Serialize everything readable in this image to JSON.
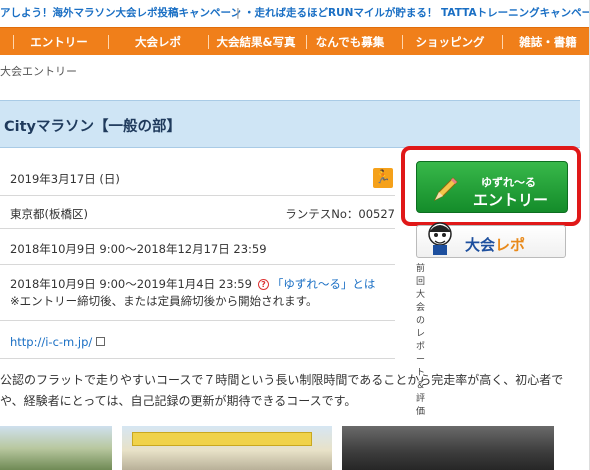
{
  "ticker": {
    "text1": "アしよう！海外マラソン大会レポ投稿キャンペーン",
    "sep": "|",
    "text2": "・走れば走るほどRUNマイルが貯まる！ TATTAトレーニングキャンペーン"
  },
  "nav": [
    "エントリー",
    "大会レポ",
    "大会結果&写真",
    "なんでも募集",
    "ショッピング",
    "雑誌・書籍"
  ],
  "breadcrumb": "大会エントリー",
  "event": {
    "title": "Cityマラソン【一般の部】",
    "date": "2019年3月17日 (日)",
    "location": "東京都(板橋区)",
    "runtes_no": "ランテスNo：00527",
    "entry_period": "2018年10月9日 9:00〜2018年12月17日 23:59",
    "yuzure_period": "2018年10月9日 9:00〜2019年1月4日 23:59",
    "yuzure_link": "「ゆずれ〜る」とは",
    "yuzure_note": "※エントリー締切後、または定員締切後から開始されます。",
    "url": "http://i-c-m.jp/",
    "description_line1": "公認のフラットで走りやすいコースで７時間という長い制限時間であることから完走率が高く、初心者で",
    "description_line2": "や、経験者にとっては、自己記録の更新が期待できるコースです。"
  },
  "side": {
    "entry_line1": "ゆずれ〜る",
    "entry_line2": "エントリー",
    "report_label_a": "大会",
    "report_label_b": "レポ",
    "report_caption": "前回大会のレポート＆評価"
  },
  "colors": {
    "nav": "#f07f1a",
    "entry_button": "#1f9e36",
    "highlight": "#e01818",
    "title_bg": "#cfe5f5"
  }
}
